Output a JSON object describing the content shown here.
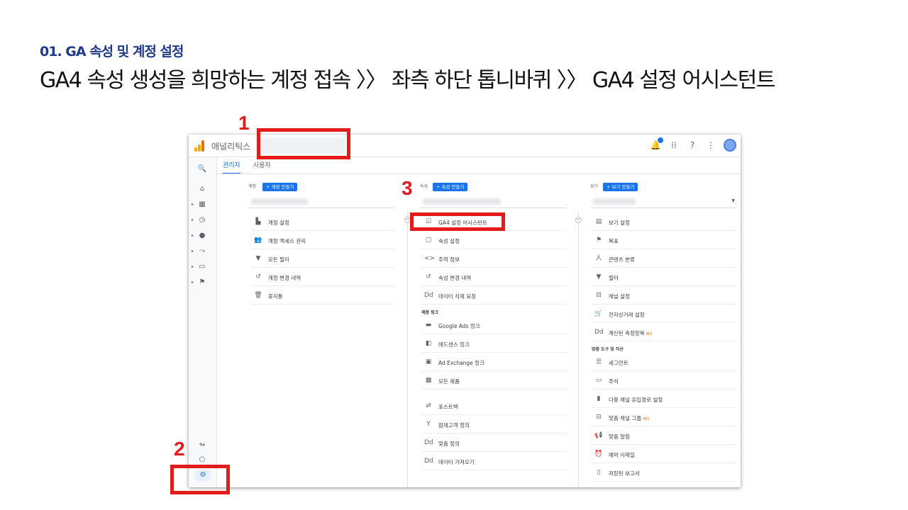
{
  "slide": {
    "subtitle": "01. GA 속성 및 계정 설정",
    "title": "GA4 속성 생성을 희망하는 계정 접속 〉〉 좌측 하단 톱니바퀴 〉〉 GA4 설정 어시스턴트"
  },
  "header": {
    "app_name": "애널리틱스",
    "icons": [
      "notifications-icon",
      "apps-grid-icon",
      "help-icon",
      "more-vert-icon",
      "account-avatar"
    ]
  },
  "sidenav": {
    "items": [
      "search-icon",
      "home-icon",
      "customization-icon",
      "realtime-icon",
      "audience-icon",
      "acquisition-icon",
      "behavior-icon",
      "conversions-icon",
      "attribution-icon",
      "discover-icon",
      "admin-gear-icon"
    ]
  },
  "tabs": [
    "관리자",
    "사용자"
  ],
  "account": {
    "label": "계정",
    "create_button": "+ 계정 만들기",
    "items": [
      {
        "icon": "building-icon",
        "label": "계정 설정"
      },
      {
        "icon": "people-icon",
        "label": "계정 액세스 관리"
      },
      {
        "icon": "filter-icon",
        "label": "모든 필터"
      },
      {
        "icon": "history-icon",
        "label": "계정 변경 내역"
      },
      {
        "icon": "trash-icon",
        "label": "휴지통"
      }
    ]
  },
  "property": {
    "label": "속성",
    "create_button": "+ 속성 만들기",
    "items": [
      {
        "icon": "checkbox-icon",
        "label": "GA4 설정 어시스턴트"
      },
      {
        "icon": "window-icon",
        "label": "속성 설정"
      },
      {
        "icon": "code-icon",
        "label": "추적 정보"
      },
      {
        "icon": "history-icon",
        "label": "속성 변경 내역"
      },
      {
        "icon": "dd-icon",
        "label": "데이터 삭제 요청"
      }
    ],
    "section_label": "제품 링크",
    "link_items": [
      {
        "icon": "ads-icon",
        "label": "Google Ads 링크"
      },
      {
        "icon": "adsense-icon",
        "label": "애드센스 링크"
      },
      {
        "icon": "adexchange-icon",
        "label": "Ad Exchange 링크"
      },
      {
        "icon": "products-icon",
        "label": "모든 제품"
      }
    ],
    "extra_items": [
      {
        "icon": "postback-icon",
        "label": "포스트백"
      },
      {
        "icon": "audience-def-icon",
        "label": "잠재고객 정의"
      },
      {
        "icon": "dd-icon",
        "label": "맞춤 정의"
      },
      {
        "icon": "dd-icon",
        "label": "데이터 가져오기"
      }
    ]
  },
  "view": {
    "label": "보기",
    "create_button": "+ 보기 만들기",
    "items": [
      {
        "icon": "doc-icon",
        "label": "보기 설정"
      },
      {
        "icon": "flag-icon",
        "label": "목표"
      },
      {
        "icon": "person-run-icon",
        "label": "콘텐츠 분류"
      },
      {
        "icon": "filter-icon",
        "label": "필터"
      },
      {
        "icon": "channel-icon",
        "label": "채널 설정"
      },
      {
        "icon": "cart-icon",
        "label": "전자상거래 설정"
      },
      {
        "icon": "dd-icon",
        "label": "계산된 측정항목",
        "beta": "베타"
      }
    ],
    "section_label": "맞춤 도구 및 자산",
    "tool_items": [
      {
        "icon": "segment-icon",
        "label": "세그먼트"
      },
      {
        "icon": "comment-icon",
        "label": "주석"
      },
      {
        "icon": "bar-chart-icon",
        "label": "다중 채널 유입경로 설정"
      },
      {
        "icon": "channel-icon",
        "label": "맞춤 채널 그룹",
        "beta": "베타"
      },
      {
        "icon": "megaphone-icon",
        "label": "맞춤 알림"
      },
      {
        "icon": "clock-icon",
        "label": "예약 이메일"
      },
      {
        "icon": "doc-icon",
        "label": "저장된 보고서"
      }
    ]
  },
  "annotations": [
    "1",
    "2",
    "3"
  ],
  "colors": {
    "accent": "#1a73e8",
    "annotation": "#e31b1b",
    "title": "#1f3a8a"
  }
}
